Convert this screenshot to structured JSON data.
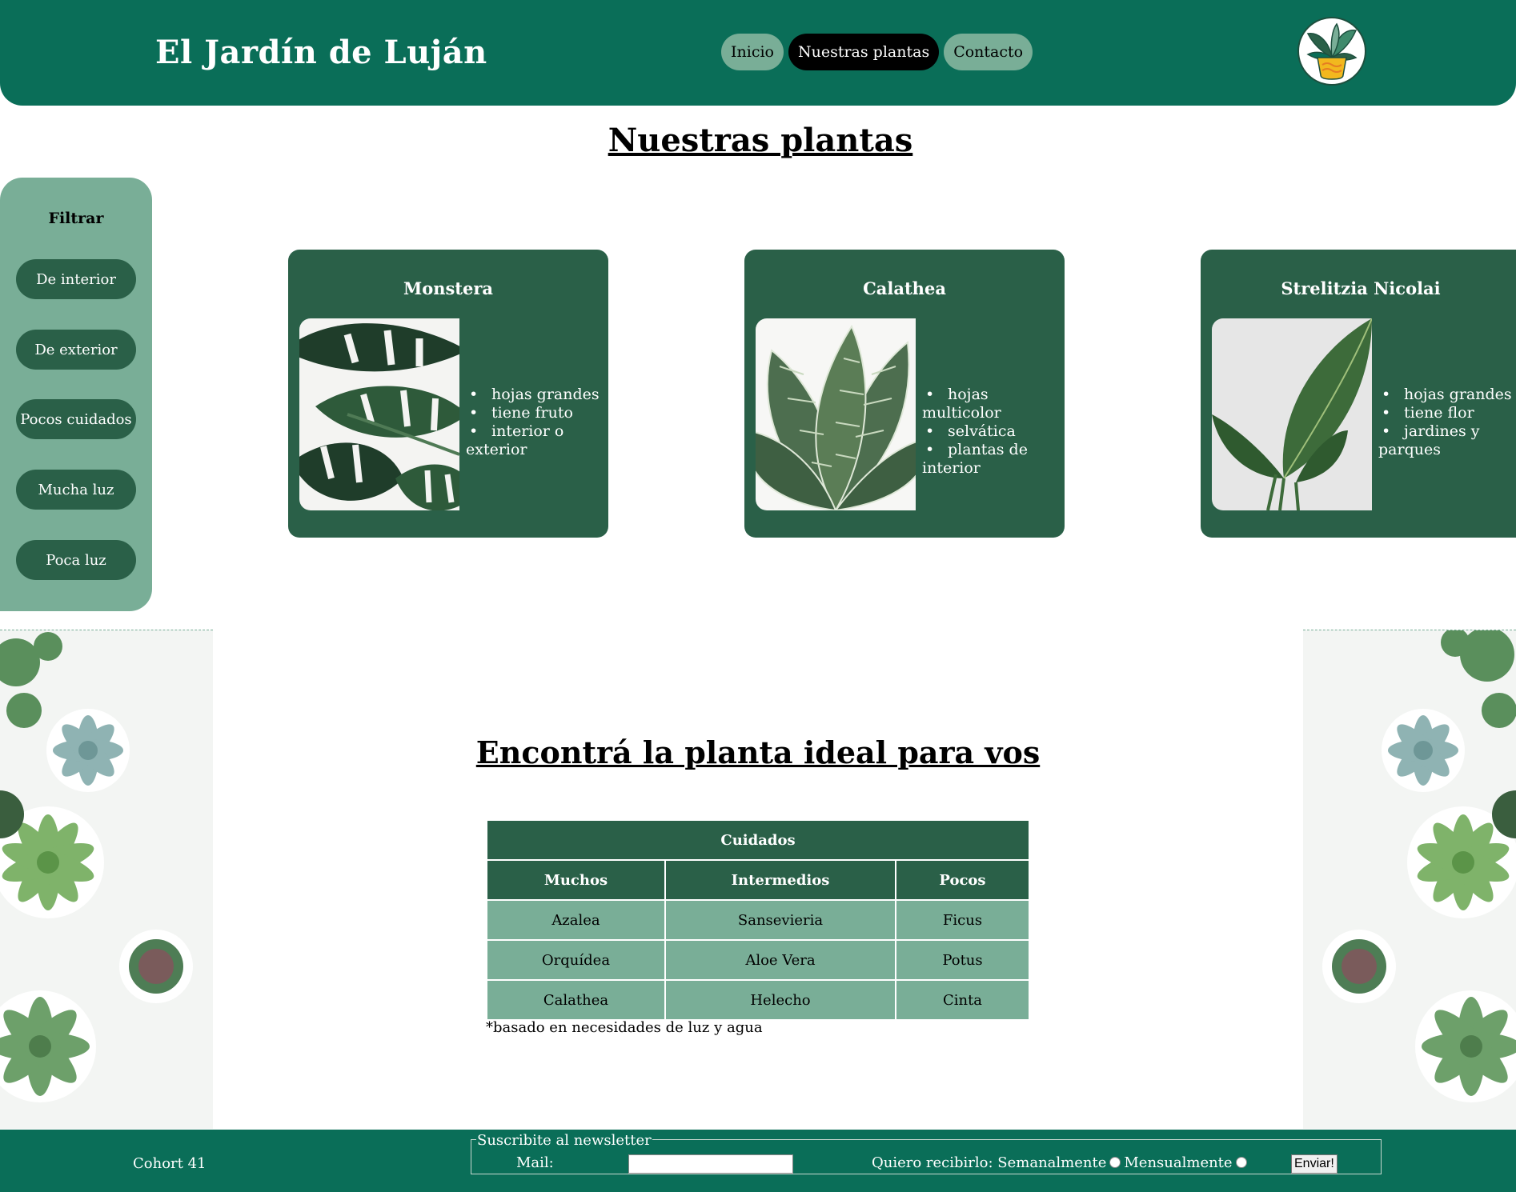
{
  "header": {
    "title": "El Jardín de Luján",
    "nav": [
      {
        "label": "Inicio",
        "active": false
      },
      {
        "label": "Nuestras plantas",
        "active": true
      },
      {
        "label": "Contacto",
        "active": false
      }
    ],
    "logo_icon": "potted-plant-icon"
  },
  "page": {
    "title": "Nuestras plantas"
  },
  "sidebar": {
    "title": "Filtrar",
    "filters": [
      "De interior",
      "De exterior",
      "Pocos cuidados",
      "Mucha luz",
      "Poca luz"
    ]
  },
  "cards": [
    {
      "title": "Monstera",
      "image_icon": "monstera-leaf-image",
      "features": [
        "hojas grandes",
        "tiene fruto",
        "interior o exterior"
      ]
    },
    {
      "title": "Calathea",
      "image_icon": "calathea-leaf-image",
      "features": [
        "hojas multicolor",
        "selvática",
        "plantas de interior"
      ]
    },
    {
      "title": "Strelitzia Nicolai",
      "image_icon": "strelitzia-leaf-image",
      "features": [
        "hojas grandes",
        "tiene flor",
        "jardines y parques"
      ]
    }
  ],
  "finder": {
    "title": "Encontrá la planta ideal para vos",
    "table": {
      "caption_header": "Cuidados",
      "columns": [
        "Muchos",
        "Intermedios",
        "Pocos"
      ],
      "rows": [
        [
          "Azalea",
          "Sansevieria",
          "Ficus"
        ],
        [
          "Orquídea",
          "Aloe Vera",
          "Potus"
        ],
        [
          "Calathea",
          "Helecho",
          "Cinta"
        ]
      ]
    },
    "note": "*basado en necesidades de luz y agua"
  },
  "footer": {
    "cohort": "Cohort 41",
    "newsletter": {
      "legend": "Suscribite al newsletter",
      "mail_label": "Mail:",
      "mail_value": "",
      "frequency_label": "Quiero recibirlo:",
      "options": [
        "Semanalmente",
        "Mensualmente"
      ],
      "submit_label": "Enviar!"
    }
  },
  "colors": {
    "header_green": "#0a6e58",
    "dark_green": "#2a6048",
    "light_green": "#79ae97",
    "white": "#ffffff",
    "black": "#000000"
  }
}
